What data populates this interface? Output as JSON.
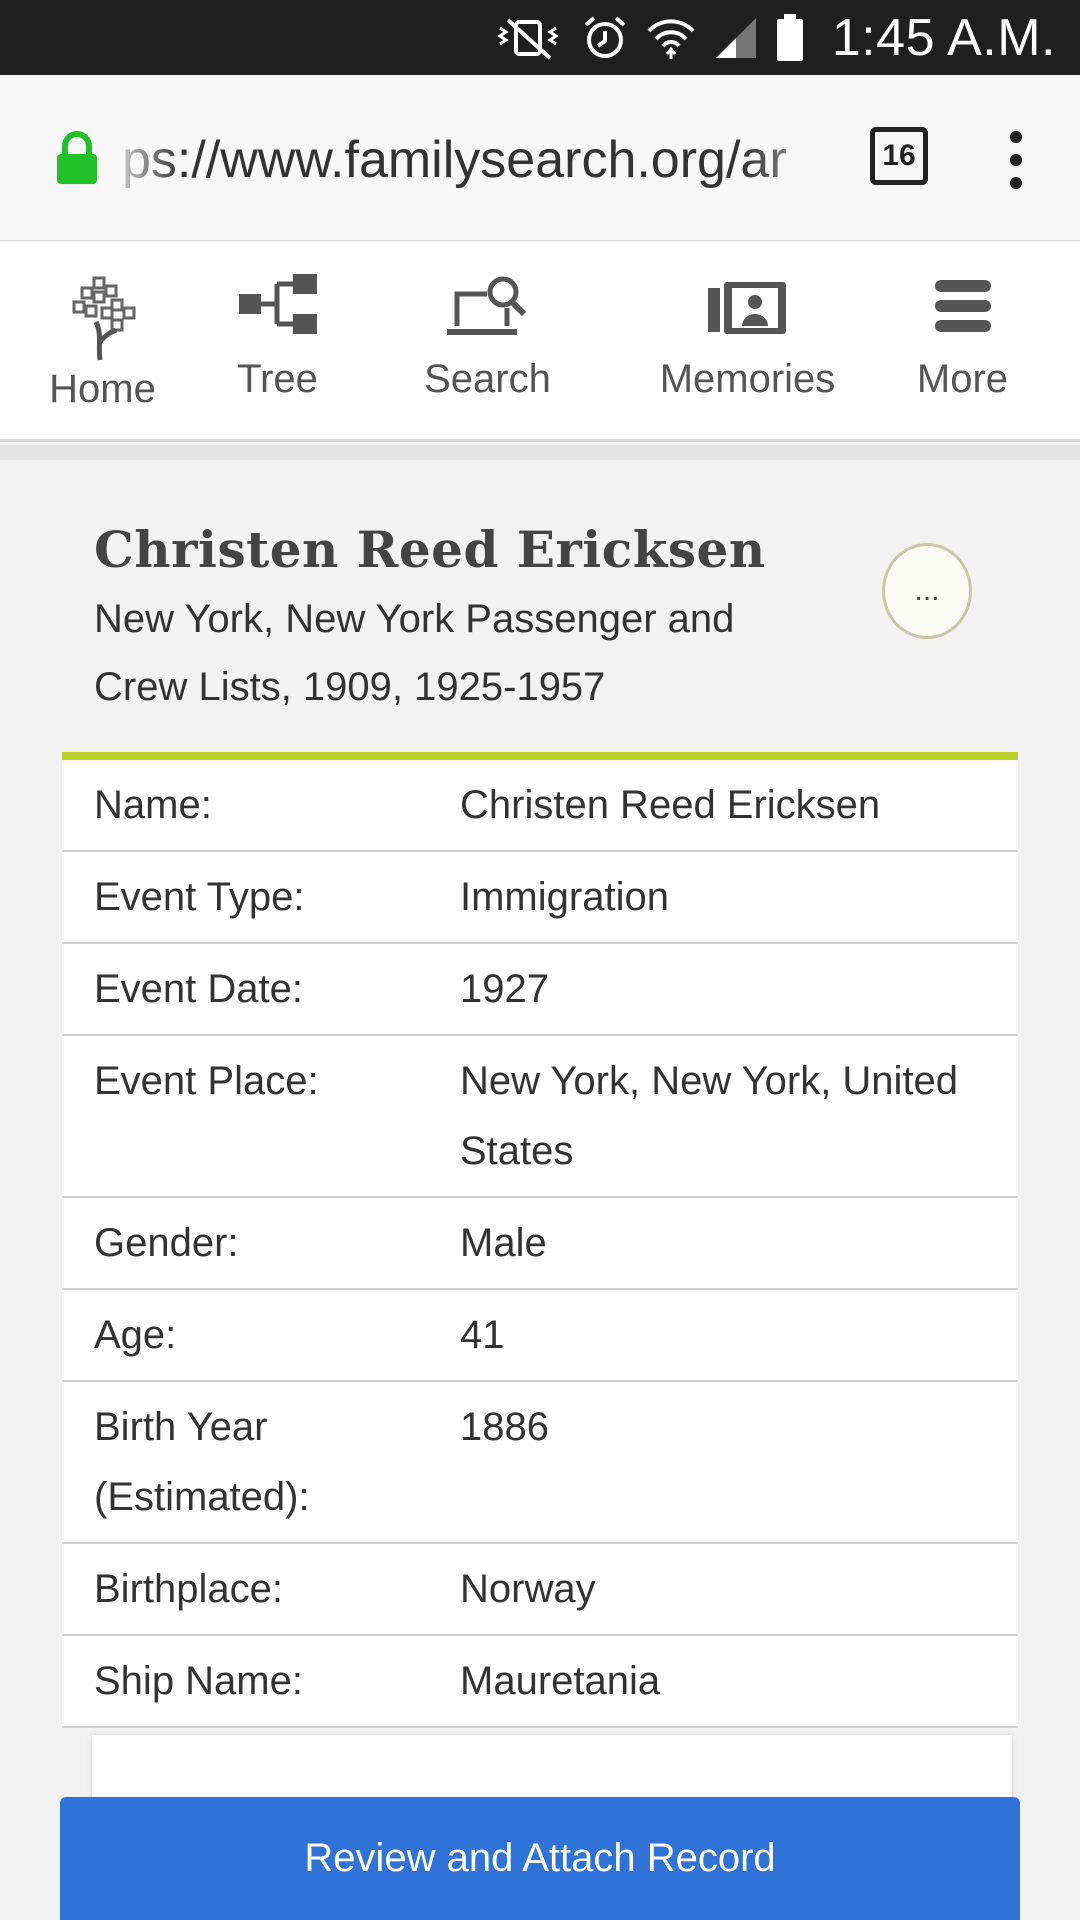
{
  "status_bar": {
    "time": "1:45 A.M.",
    "icons": [
      "vibrate-muted-icon",
      "alarm-icon",
      "wifi-icon",
      "cell-signal-icon",
      "battery-icon"
    ]
  },
  "browser": {
    "url": "ps://www.familysearch.org/ar",
    "tab_count": "16"
  },
  "nav": {
    "items": [
      {
        "label": "Home",
        "icon": "tree-logo-icon"
      },
      {
        "label": "Tree",
        "icon": "tree-chart-icon"
      },
      {
        "label": "Search",
        "icon": "laptop-search-icon"
      },
      {
        "label": "Memories",
        "icon": "photos-icon"
      },
      {
        "label": "More",
        "icon": "hamburger-menu-icon"
      }
    ]
  },
  "record": {
    "name": "Christen Reed Ericksen",
    "collection": "New York, New York Passenger and Crew Lists, 1909, 1925-1957",
    "options_label": "...",
    "rows": [
      {
        "label": "Name:",
        "value": "Christen Reed Ericksen"
      },
      {
        "label": "Event Type:",
        "value": "Immigration"
      },
      {
        "label": "Event Date:",
        "value": "1927"
      },
      {
        "label": "Event Place:",
        "value": "New York, New York, United States"
      },
      {
        "label": "Gender:",
        "value": "Male"
      },
      {
        "label": "Age:",
        "value": "41"
      },
      {
        "label": "Birth Year (Estimated):",
        "value": "1886"
      },
      {
        "label": "Birthplace:",
        "value": "Norway"
      },
      {
        "label": "Ship Name:",
        "value": "Mauretania"
      }
    ]
  },
  "actions": {
    "attach_label": "Review and Attach Record"
  },
  "colors": {
    "accent_green": "#b8cf2c",
    "button_blue": "#2f73d8",
    "lock_green": "#21c12a"
  }
}
